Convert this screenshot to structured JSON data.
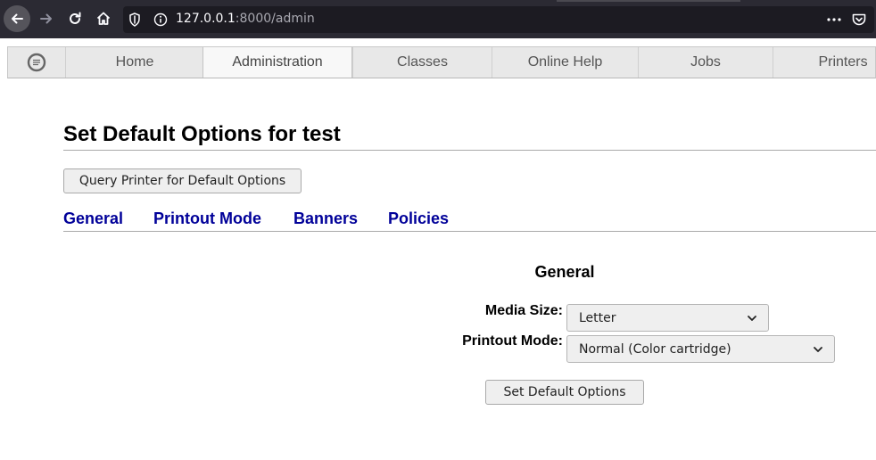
{
  "browser": {
    "url_host": "127.0.0.1",
    "url_port_path": ":8000/admin",
    "icons": [
      "back-arrow-icon",
      "forward-arrow-icon",
      "reload-icon",
      "home-icon",
      "shield-icon",
      "info-icon",
      "more-dots-icon",
      "pocket-icon"
    ],
    "colors": {
      "toolbar": "#2b2a33",
      "urlbar": "#1c1b22"
    }
  },
  "tabs": [
    {
      "label": "Home"
    },
    {
      "label": "Administration",
      "active": true
    },
    {
      "label": "Classes"
    },
    {
      "label": "Online Help"
    },
    {
      "label": "Jobs"
    },
    {
      "label": "Printers"
    }
  ],
  "page": {
    "title": "Set Default Options for test",
    "query_button": "Query Printer for Default Options",
    "sections": [
      "General",
      "Printout Mode",
      "Banners",
      "Policies"
    ],
    "group_heading": "General",
    "fields": [
      {
        "label": "Media Size:",
        "value": "Letter"
      },
      {
        "label": "Printout Mode:",
        "value": "Normal (Color cartridge)"
      }
    ],
    "submit_button": "Set Default Options"
  },
  "colors": {
    "link": "#000099",
    "tab_bg": "#e8e8e8",
    "tab_active_bg": "#f8f8f8"
  }
}
